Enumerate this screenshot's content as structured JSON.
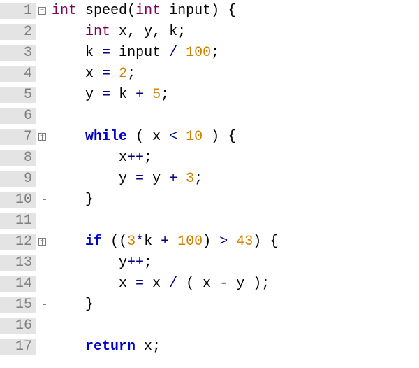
{
  "language": "c",
  "lines": {
    "l1": {
      "n": "1",
      "fold": "box",
      "indent": 0
    },
    "l2": {
      "n": "2",
      "fold": "pipe",
      "indent": 1
    },
    "l3": {
      "n": "3",
      "fold": "pipe",
      "indent": 1
    },
    "l4": {
      "n": "4",
      "fold": "pipe",
      "indent": 1
    },
    "l5": {
      "n": "5",
      "fold": "pipe",
      "indent": 1
    },
    "l6": {
      "n": "6",
      "fold": "pipe",
      "indent": 0
    },
    "l7": {
      "n": "7",
      "fold": "box_mid",
      "indent": 1
    },
    "l8": {
      "n": "8",
      "fold": "pipe",
      "indent": 2
    },
    "l9": {
      "n": "9",
      "fold": "pipe",
      "indent": 2
    },
    "l10": {
      "n": "10",
      "fold": "tee",
      "indent": 1
    },
    "l11": {
      "n": "11",
      "fold": "pipe",
      "indent": 0
    },
    "l12": {
      "n": "12",
      "fold": "box_mid",
      "indent": 1
    },
    "l13": {
      "n": "13",
      "fold": "pipe",
      "indent": 2
    },
    "l14": {
      "n": "14",
      "fold": "pipe",
      "indent": 2
    },
    "l15": {
      "n": "15",
      "fold": "tee",
      "indent": 1
    },
    "l16": {
      "n": "16",
      "fold": "pipe",
      "indent": 0
    },
    "l17": {
      "n": "17",
      "fold": "pipe",
      "indent": 1
    }
  },
  "tok": {
    "int": "int",
    "while": "while",
    "if": "if",
    "return": "return",
    "speed": "speed",
    "input": "input",
    "x": "x",
    "y": "y",
    "k": "k",
    "n2": "2",
    "n3": "3",
    "n5": "5",
    "n10": "10",
    "n43": "43",
    "n100": "100",
    "lparen": "(",
    "rparen": ")",
    "lbrace": "{",
    "rbrace": "}",
    "comma": ",",
    "semi": ";",
    "eq": "=",
    "plus": "+",
    "minus": "-",
    "slash": "/",
    "lt": "<",
    "gt": ">",
    "star": "*",
    "pp": "++",
    "sp": " "
  }
}
